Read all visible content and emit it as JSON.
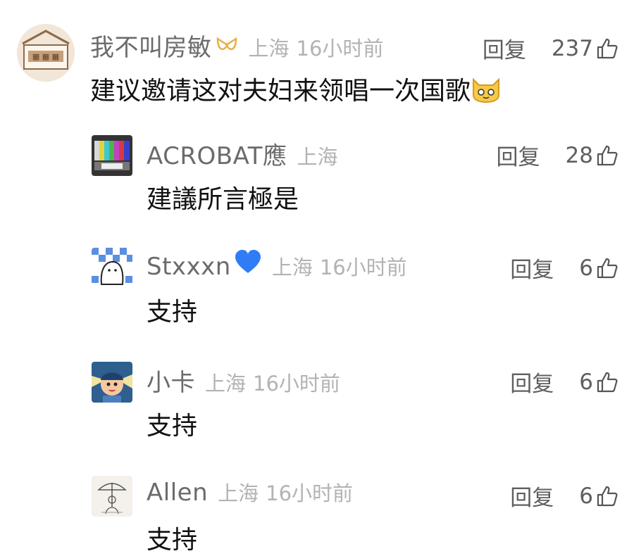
{
  "comments": [
    {
      "username": "我不叫房敏",
      "badge": "♡",
      "location": "上海",
      "time": "16小时前",
      "reply_label": "回复",
      "likes": "237",
      "text": "建议邀请这对夫妇来领唱一次国歌",
      "avatar_icon": "house-sign-avatar",
      "emoji_icon": "cat-face-emoji"
    },
    {
      "username": "ACROBAT應",
      "location": "上海",
      "time": "",
      "reply_label": "回复",
      "likes": "28",
      "text": "建議所言極是",
      "avatar_icon": "tv-test-pattern-avatar"
    },
    {
      "username": "Stxxxn",
      "badge": "💙",
      "location": "上海",
      "time": "16小时前",
      "reply_label": "回复",
      "likes": "6",
      "text": "支持",
      "avatar_icon": "checker-blob-avatar"
    },
    {
      "username": "小卡",
      "location": "上海",
      "time": "16小时前",
      "reply_label": "回复",
      "likes": "6",
      "text": "支持",
      "avatar_icon": "cartoon-kid-avatar"
    },
    {
      "username": "Allen",
      "location": "上海",
      "time": "16小时前",
      "reply_label": "回复",
      "likes": "6",
      "text": "支持",
      "avatar_icon": "umbrella-sketch-avatar"
    }
  ],
  "colors": {
    "username": "#6b6b6b",
    "meta": "#b3b3b3",
    "text": "#111111",
    "badge_gold": "#e8b04a",
    "badge_blue": "#2f7cf6"
  }
}
